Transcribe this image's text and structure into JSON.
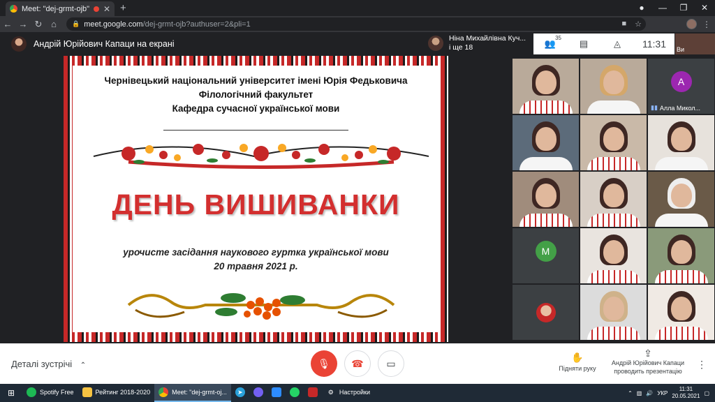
{
  "browser": {
    "tab_title": "Meet: \"dej-grmt-ojb\"",
    "url_host": "meet.google.com",
    "url_path": "/dej-grmt-ojb?authuser=2&pli=1"
  },
  "meet": {
    "presenter_label": "Андрій Юрійович Капаци на екрані",
    "people_name": "Ніна Михайлівна Куч...",
    "people_more": "і ще 18",
    "participant_count": "35",
    "clock": "11:31",
    "self_label": "Ви"
  },
  "slide": {
    "university": "Чернівецький національний університет імені Юрія Федьковича",
    "faculty": "Філологічний факультет",
    "department": "Кафедра сучасної української мови",
    "headline": "ДЕНЬ ВИШИВАНКИ",
    "subtitle": "урочисте засідання наукового гуртка української мови",
    "date": "20 травня 2021 р."
  },
  "tiles": [
    {
      "type": "video",
      "shirt": "emb"
    },
    {
      "type": "video",
      "hair": "#d4a76a",
      "shirt": "plain"
    },
    {
      "type": "avatar",
      "letter": "A",
      "color": "#9c27b0",
      "name": "Алла Микол..."
    },
    {
      "type": "video",
      "shirt": "plain",
      "bg": "#5c6b7a"
    },
    {
      "type": "video",
      "shirt": "emb",
      "bg": "#c9b9a8"
    },
    {
      "type": "video",
      "shirt": "plain",
      "bg": "#e7e2dc"
    },
    {
      "type": "video",
      "shirt": "emb",
      "bg": "#a08c7c"
    },
    {
      "type": "video",
      "shirt": "emb",
      "bg": "#d8cfc6"
    },
    {
      "type": "video",
      "hair": "#eeeeee",
      "shirt": "plain",
      "bg": "#6a5a48"
    },
    {
      "type": "avatar",
      "letter": "M",
      "color": "#43a047"
    },
    {
      "type": "video",
      "shirt": "emb",
      "bg": "#e9e4df"
    },
    {
      "type": "video",
      "shirt": "emb",
      "bg": "#8a9a7a"
    },
    {
      "type": "photo"
    },
    {
      "type": "video",
      "hair": "#cfb28a",
      "shirt": "emb",
      "bg": "#dcdcdc"
    },
    {
      "type": "video",
      "shirt": "emb",
      "bg": "#f0eae4"
    }
  ],
  "controls": {
    "details": "Деталі зустрічі",
    "raise_hand": "Підняти руку",
    "presenter_line1": "Андрій Юрійович Капаци",
    "presenter_line2": "проводить презентацію"
  },
  "taskbar": {
    "items": [
      "Spotify Free",
      "Рейтинг 2018-2020",
      "Meet: \"dej-grmt-oj...",
      "Настройки"
    ],
    "lang": "УКР",
    "time": "11:31",
    "date": "20.05.2021"
  },
  "colors": {
    "accent_red": "#ea4335",
    "headline_red": "#d32f2f",
    "meet_bg": "#202124"
  }
}
